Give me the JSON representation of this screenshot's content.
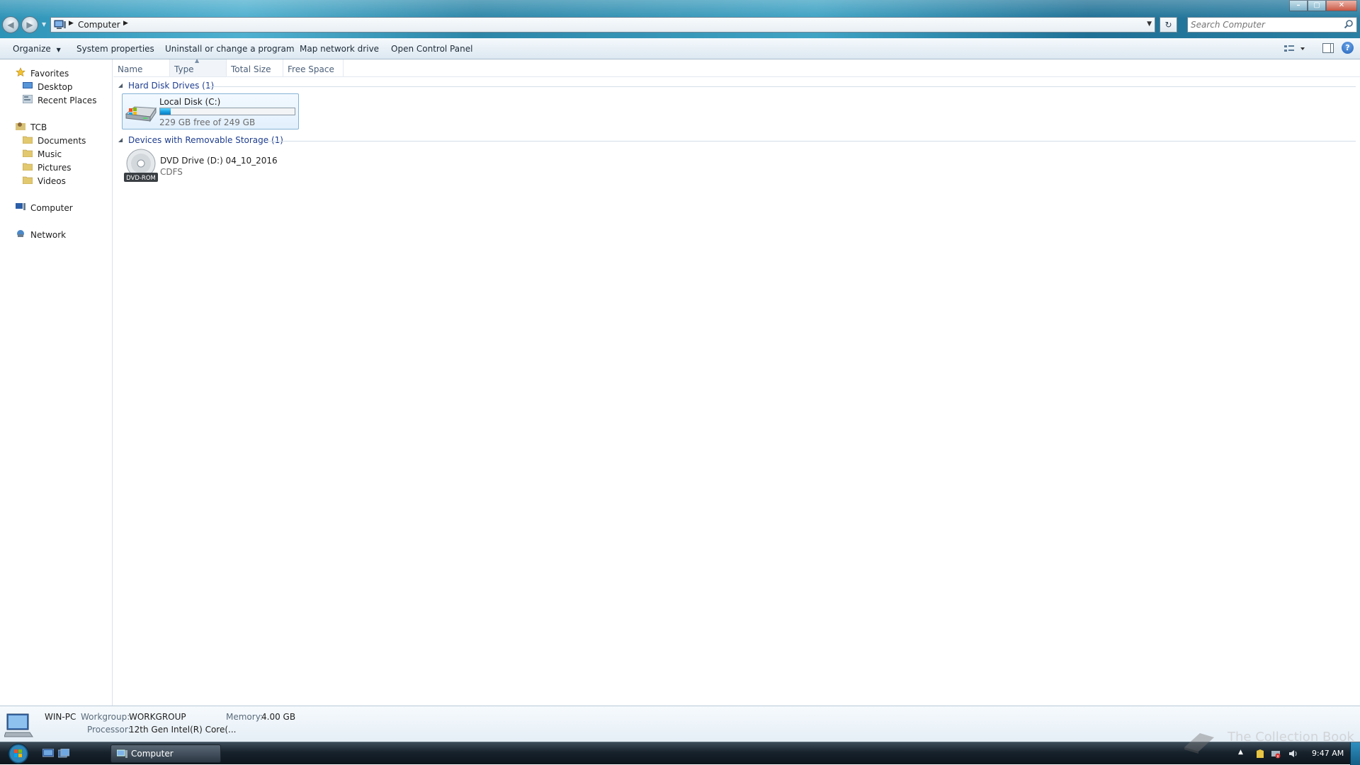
{
  "window": {
    "address": {
      "location": "Computer"
    },
    "search": {
      "placeholder": "Search Computer"
    },
    "controls": {
      "minimize": "",
      "maximize": "",
      "close": ""
    }
  },
  "toolbar": {
    "organize": "Organize",
    "system_properties": "System properties",
    "uninstall": "Uninstall or change a program",
    "map_drive": "Map network drive",
    "control_panel": "Open Control Panel"
  },
  "nav": {
    "favorites": "Favorites",
    "desktop": "Desktop",
    "recent": "Recent Places",
    "user": "TCB",
    "documents": "Documents",
    "music": "Music",
    "pictures": "Pictures",
    "videos": "Videos",
    "computer": "Computer",
    "network": "Network"
  },
  "columns": [
    "Name",
    "Type",
    "Total Size",
    "Free Space"
  ],
  "groups": {
    "hdd": "Hard Disk Drives (1)",
    "removable": "Devices with Removable Storage (1)"
  },
  "drives": {
    "c": {
      "name": "Local Disk (C:)",
      "free_text": "229 GB free of 249 GB",
      "used_fraction": 0.08
    },
    "d": {
      "name": "DVD Drive (D:) 04_10_2016",
      "fs": "CDFS",
      "badge": "DVD-ROM"
    }
  },
  "details": {
    "pc_name": "WIN-PC",
    "workgroup_label": "Workgroup:",
    "workgroup": "WORKGROUP",
    "memory_label": "Memory:",
    "memory": "4.00 GB",
    "processor_label": "Processor:",
    "processor": "12th Gen Intel(R) Core(..."
  },
  "taskbar": {
    "task_computer": "Computer",
    "clock": "9:47 AM"
  },
  "watermark": "The Collection Book",
  "colors": {
    "accent": "#1e3d8f",
    "bar_fill": "#1ba1e2",
    "selection": "#e2f0fd"
  }
}
